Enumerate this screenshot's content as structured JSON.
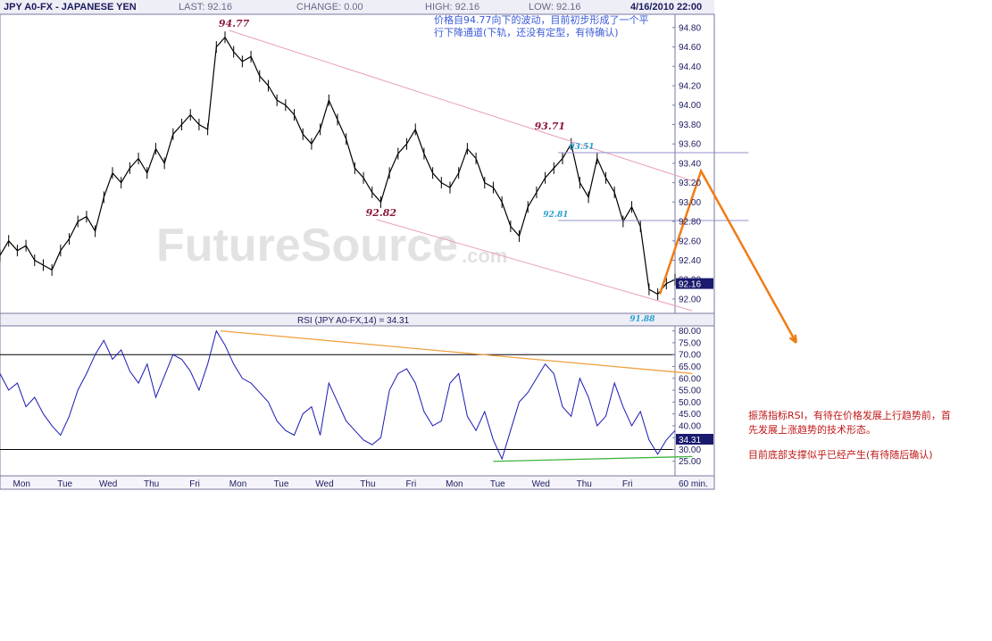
{
  "header": {
    "symbol": "JPY A0-FX - JAPANESE YEN",
    "last_label": "LAST:",
    "last_value": "92.16",
    "change_label": "CHANGE:",
    "change_value": "0.00",
    "high_label": "HIGH:",
    "high_value": "92.16",
    "low_label": "LOW:",
    "low_value": "92.16",
    "datetime": "4/16/2010 22:00"
  },
  "colors": {
    "header_bg": "#eeeef6",
    "header_text": "#1a1a5e",
    "price_line": "#000000",
    "channel_line": "#e8a0b4",
    "marker_line": "#9090c8",
    "rsi_line": "#1a1ab4",
    "rsi_trend_top": "#f0a040",
    "rsi_trend_bottom": "#3cb43c",
    "projection": "#f07c14",
    "annotation_red": "#8b1a3a",
    "annotation_cyan": "#2aa0d0",
    "note_blue": "#3a5ad8",
    "note_red": "#c01818",
    "last_price_box": "#1a1a6e"
  },
  "watermark": "FutureSource",
  "watermark_suffix": ".com",
  "chart_data": [
    {
      "type": "line",
      "title": "JPY A0-FX - JAPANESE YEN",
      "interval": "60 min.",
      "ylim": [
        91.88,
        94.9
      ],
      "yticks": [
        94.8,
        94.6,
        94.4,
        94.2,
        94.0,
        93.8,
        93.6,
        93.4,
        93.2,
        93.0,
        92.8,
        92.6,
        92.4,
        92.2,
        92.0
      ],
      "ytick_labels": [
        "94.80",
        "94.60",
        "94.40",
        "94.20",
        "94.00",
        "93.80",
        "93.60",
        "93.40",
        "93.20",
        "93.00",
        "92.80",
        "92.60",
        "92.40",
        "92.20",
        "92.00"
      ],
      "x_labels": [
        "Mon",
        "Tue",
        "Wed",
        "Thu",
        "Fri",
        "Mon",
        "Tue",
        "Wed",
        "Thu",
        "Fri",
        "Mon",
        "Tue",
        "Wed",
        "Thu",
        "Fri"
      ],
      "x_label_positions": [
        0.5,
        1.5,
        2.5,
        3.5,
        4.5,
        5.5,
        6.5,
        7.5,
        8.5,
        9.5,
        10.5,
        11.5,
        12.5,
        13.5,
        14.5
      ],
      "x_range": [
        0,
        15.6
      ],
      "last_price": "92.16",
      "series": [
        {
          "values_x": [
            0.0,
            0.2,
            0.4,
            0.6,
            0.8,
            1.0,
            1.2,
            1.4,
            1.6,
            1.8,
            2.0,
            2.2,
            2.4,
            2.6,
            2.8,
            3.0,
            3.2,
            3.4,
            3.6,
            3.8,
            4.0,
            4.2,
            4.4,
            4.6,
            4.8,
            5.0,
            5.2,
            5.4,
            5.6,
            5.8,
            6.0,
            6.2,
            6.4,
            6.6,
            6.8,
            7.0,
            7.2,
            7.4,
            7.6,
            7.8,
            8.0,
            8.2,
            8.4,
            8.6,
            8.8,
            9.0,
            9.2,
            9.4,
            9.6,
            9.8,
            10.0,
            10.2,
            10.4,
            10.6,
            10.8,
            11.0,
            11.2,
            11.4,
            11.6,
            11.8,
            12.0,
            12.2,
            12.4,
            12.6,
            12.8,
            13.0,
            13.2,
            13.4,
            13.6,
            13.8,
            14.0,
            14.2,
            14.4,
            14.6,
            14.8,
            15.0,
            15.2,
            15.4,
            15.6
          ],
          "values_y": [
            92.45,
            92.6,
            92.5,
            92.55,
            92.4,
            92.35,
            92.3,
            92.5,
            92.62,
            92.8,
            92.85,
            92.7,
            93.05,
            93.3,
            93.2,
            93.35,
            93.45,
            93.3,
            93.55,
            93.4,
            93.7,
            93.8,
            93.9,
            93.8,
            93.75,
            94.6,
            94.7,
            94.55,
            94.45,
            94.5,
            94.3,
            94.2,
            94.05,
            94.0,
            93.9,
            93.7,
            93.6,
            93.75,
            94.05,
            93.85,
            93.65,
            93.35,
            93.25,
            93.1,
            93.0,
            93.3,
            93.5,
            93.6,
            93.75,
            93.5,
            93.3,
            93.2,
            93.15,
            93.3,
            93.55,
            93.45,
            93.2,
            93.15,
            93.0,
            92.75,
            92.65,
            92.95,
            93.1,
            93.25,
            93.35,
            93.45,
            93.6,
            93.2,
            93.05,
            93.45,
            93.25,
            93.1,
            92.8,
            92.95,
            92.75,
            92.1,
            92.05,
            92.16,
            92.2
          ]
        }
      ],
      "channel": {
        "upper": [
          [
            5.3,
            94.77
          ],
          [
            16.0,
            93.22
          ]
        ],
        "lower": [
          [
            8.7,
            92.82
          ],
          [
            16.0,
            91.88
          ]
        ]
      },
      "horizontal_levels": [
        {
          "y": 93.51,
          "x_from": 12.9,
          "x_to": 17.3
        },
        {
          "y": 92.81,
          "x_from": 12.9,
          "x_to": 17.3
        }
      ],
      "annotations": [
        {
          "text": "94.77",
          "x": 5.3,
          "y": 94.77,
          "color": "annotation_red",
          "size": 11
        },
        {
          "text": "92.82",
          "x": 8.7,
          "y": 92.82,
          "color": "annotation_red",
          "size": 11
        },
        {
          "text": "93.71",
          "x": 12.6,
          "y": 93.71,
          "color": "annotation_red",
          "size": 11
        },
        {
          "text": "93.51",
          "x": 13.4,
          "y": 93.51,
          "color": "annotation_cyan",
          "size": 9
        },
        {
          "text": "92.81",
          "x": 12.8,
          "y": 92.81,
          "color": "annotation_cyan",
          "size": 9
        },
        {
          "text": "91.88",
          "x": 14.8,
          "y": 91.88,
          "color": "annotation_cyan",
          "size": 9
        }
      ],
      "projection_path": [
        [
          15.25,
          92.05
        ],
        [
          16.2,
          93.32
        ],
        [
          18.4,
          91.55
        ]
      ]
    },
    {
      "type": "line",
      "title": "RSI (JPY A0-FX,14) = 34.31",
      "ylim": [
        20,
        81
      ],
      "yticks": [
        80,
        75,
        70,
        65,
        60,
        55,
        50,
        45,
        40,
        35,
        30,
        25
      ],
      "ytick_labels": [
        "80.00",
        "75.00",
        "70.00",
        "65.00",
        "60.00",
        "55.00",
        "50.00",
        "45.00",
        "40.00",
        "35.00",
        "30.00",
        "25.00"
      ],
      "reference_lines": [
        70,
        30
      ],
      "last_value": "34.31",
      "series": [
        {
          "name": "RSI",
          "values_x": [
            0.0,
            0.2,
            0.4,
            0.6,
            0.8,
            1.0,
            1.2,
            1.4,
            1.6,
            1.8,
            2.0,
            2.2,
            2.4,
            2.6,
            2.8,
            3.0,
            3.2,
            3.4,
            3.6,
            3.8,
            4.0,
            4.2,
            4.4,
            4.6,
            4.8,
            5.0,
            5.2,
            5.4,
            5.6,
            5.8,
            6.0,
            6.2,
            6.4,
            6.6,
            6.8,
            7.0,
            7.2,
            7.4,
            7.6,
            7.8,
            8.0,
            8.2,
            8.4,
            8.6,
            8.8,
            9.0,
            9.2,
            9.4,
            9.6,
            9.8,
            10.0,
            10.2,
            10.4,
            10.6,
            10.8,
            11.0,
            11.2,
            11.4,
            11.6,
            11.8,
            12.0,
            12.2,
            12.4,
            12.6,
            12.8,
            13.0,
            13.2,
            13.4,
            13.6,
            13.8,
            14.0,
            14.2,
            14.4,
            14.6,
            14.8,
            15.0,
            15.2,
            15.4,
            15.6
          ],
          "values_y": [
            62,
            55,
            58,
            48,
            52,
            45,
            40,
            36,
            44,
            55,
            62,
            70,
            76,
            68,
            72,
            63,
            58,
            66,
            52,
            61,
            70,
            68,
            63,
            55,
            66,
            80,
            74,
            66,
            60,
            58,
            54,
            50,
            42,
            38,
            36,
            45,
            48,
            36,
            58,
            50,
            42,
            38,
            34,
            32,
            35,
            55,
            62,
            64,
            58,
            46,
            40,
            42,
            58,
            62,
            44,
            38,
            46,
            34,
            26,
            38,
            50,
            54,
            60,
            66,
            62,
            48,
            44,
            60,
            52,
            40,
            44,
            58,
            48,
            40,
            46,
            34,
            28,
            34,
            38
          ]
        }
      ],
      "trend_top": [
        [
          5.1,
          80
        ],
        [
          16.0,
          62
        ]
      ],
      "trend_bottom": [
        [
          11.4,
          25
        ],
        [
          16.0,
          27
        ]
      ]
    }
  ],
  "notes": {
    "top_text_line1": "价格自94.77向下的波动，目前初步形成了一个平",
    "top_text_line2": "行下降通道(下轨，还没有定型，有待确认)",
    "rsi_text_line1": "振荡指标RSI，有待在价格发展上行趋势前，首",
    "rsi_text_line2": "先发展上涨趋势的技术形态。",
    "rsi_text_line3": "目前底部支撑似乎已经产生(有待随后确认)"
  }
}
